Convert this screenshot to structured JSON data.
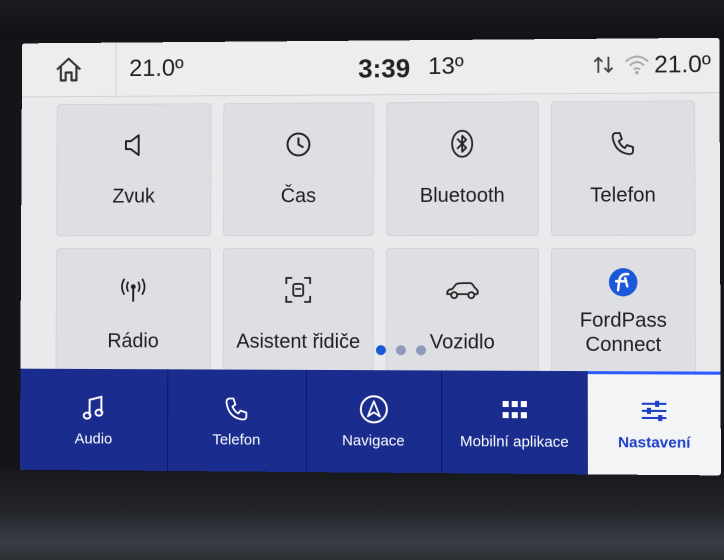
{
  "status": {
    "temp_left": "21.0º",
    "time": "3:39",
    "outside_temp": "13º",
    "temp_right": "21.0º",
    "icons": [
      "home-icon",
      "data-transfer-icon",
      "wifi-icon"
    ]
  },
  "tiles": [
    {
      "label": "Zvuk",
      "icon": "speaker-icon"
    },
    {
      "label": "Čas",
      "icon": "clock-icon"
    },
    {
      "label": "Bluetooth",
      "icon": "bluetooth-icon"
    },
    {
      "label": "Telefon",
      "icon": "phone-icon"
    },
    {
      "label": "Rádio",
      "icon": "radio-antenna-icon"
    },
    {
      "label": "Asistent řidiče",
      "icon": "driver-assist-icon"
    },
    {
      "label": "Vozidlo",
      "icon": "car-icon"
    },
    {
      "label": "FordPass Connect",
      "icon": "fordpass-icon"
    }
  ],
  "pagination": {
    "pages": 3,
    "current": 1
  },
  "nav": [
    {
      "label": "Audio",
      "icon": "music-note-icon",
      "active": false
    },
    {
      "label": "Telefon",
      "icon": "phone-icon",
      "active": false
    },
    {
      "label": "Navigace",
      "icon": "navigation-arrow-icon",
      "active": false
    },
    {
      "label": "Mobilní aplikace",
      "icon": "apps-grid-icon",
      "active": false
    },
    {
      "label": "Nastavení",
      "icon": "sliders-icon",
      "active": true
    }
  ],
  "colors": {
    "nav_background": "#1a2c8e",
    "accent": "#1b58d8",
    "screen_background": "#e9eaec"
  }
}
